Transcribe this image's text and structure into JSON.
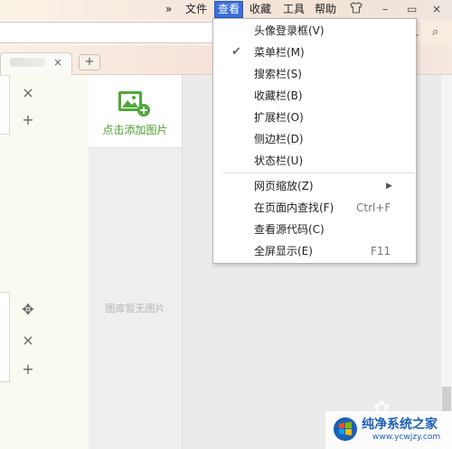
{
  "menubar": {
    "overflow": "»",
    "items": [
      "文件",
      "查看",
      "收藏",
      "工具",
      "帮助"
    ],
    "active_index": 1,
    "shirt_icon": "shirt-icon",
    "minimize": "–",
    "restore": "▭",
    "close": "×"
  },
  "tabs": {
    "close": "×",
    "new_tab": "+"
  },
  "left_panel": {
    "close1": "×",
    "add1": "+",
    "move": "✥",
    "close2": "×",
    "add2": "+"
  },
  "image_library": {
    "add_label": "点击添加图片",
    "empty_text": "图库暂无图片"
  },
  "view_menu": {
    "items": [
      {
        "label": "头像登录框(V)",
        "shortcut": "",
        "checked": false,
        "submenu": false
      },
      {
        "label": "菜单栏(M)",
        "shortcut": "",
        "checked": true,
        "submenu": false
      },
      {
        "label": "搜索栏(S)",
        "shortcut": "",
        "checked": false,
        "submenu": false
      },
      {
        "label": "收藏栏(B)",
        "shortcut": "",
        "checked": false,
        "submenu": false
      },
      {
        "label": "扩展栏(O)",
        "shortcut": "",
        "checked": false,
        "submenu": false
      },
      {
        "label": "侧边栏(D)",
        "shortcut": "",
        "checked": false,
        "submenu": false
      },
      {
        "label": "状态栏(U)",
        "shortcut": "",
        "checked": false,
        "submenu": false
      },
      {
        "label": "网页缩放(Z)",
        "shortcut": "",
        "checked": false,
        "submenu": true
      },
      {
        "label": "在页面内查找(F)",
        "shortcut": "Ctrl+F",
        "checked": false,
        "submenu": false
      },
      {
        "label": "查看源代码(C)",
        "shortcut": "",
        "checked": false,
        "submenu": false
      },
      {
        "label": "全屏显示(E)",
        "shortcut": "F11",
        "checked": false,
        "submenu": false
      }
    ],
    "check_glyph": "✔",
    "arrow_glyph": "▶"
  },
  "watermark": {
    "title": "纯净系统之家",
    "url": "www.ycwjzy.com"
  },
  "colors": {
    "accent": "#3d6fd8",
    "green": "#4a9c2d",
    "brand_blue": "#1d5fb8"
  }
}
